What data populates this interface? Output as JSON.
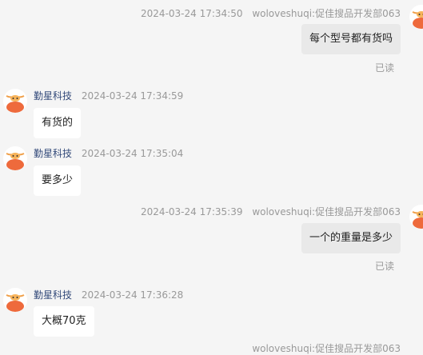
{
  "messages": [
    {
      "side": "right",
      "time": "2024-03-24 17:34:50",
      "sender": "woloveshuqi:促佳搜品开发部063",
      "text": "每个型号都有货吗",
      "status": "已读"
    },
    {
      "side": "left",
      "time": "2024-03-24 17:34:59",
      "sender": "勤星科技",
      "text": "有货的"
    },
    {
      "side": "left",
      "time": "2024-03-24 17:35:04",
      "sender": "勤星科技",
      "text": "要多少"
    },
    {
      "side": "right",
      "time": "2024-03-24 17:35:39",
      "sender": "woloveshuqi:促佳搜品开发部063",
      "text": "一个的重量是多少",
      "status": "已读"
    },
    {
      "side": "left",
      "time": "2024-03-24 17:36:28",
      "sender": "勤星科技",
      "text": "大概70克"
    }
  ],
  "footer_partial": "woloveshuqi:促佳搜品开发部063",
  "colors": {
    "background": "#f5f5f5",
    "bubble_right": "#e9e9e9",
    "bubble_left": "#ffffff",
    "sender_left": "#334a7a",
    "meta": "#999999"
  },
  "avatar_icon": "cartoon-bull-avatar-icon"
}
